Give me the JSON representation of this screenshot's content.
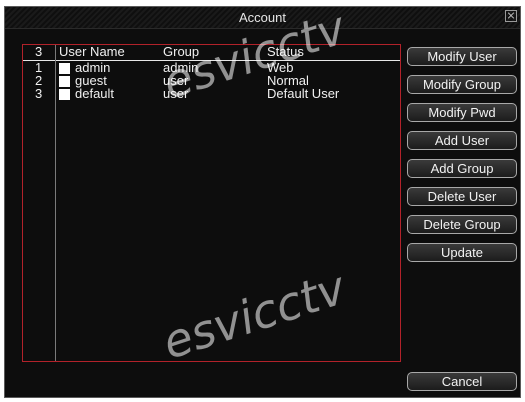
{
  "window": {
    "title": "Account"
  },
  "user_list": {
    "count": "3",
    "columns": [
      "User Name",
      "Group",
      "Status"
    ],
    "rows": [
      {
        "index": "1",
        "name": "admin",
        "group": "admin",
        "status": "Web"
      },
      {
        "index": "2",
        "name": "guest",
        "group": "user",
        "status": "Normal"
      },
      {
        "index": "3",
        "name": "default",
        "group": "user",
        "status": "Default User"
      }
    ]
  },
  "buttons": {
    "modify_user": "Modify User",
    "modify_group": "Modify Group",
    "modify_pwd": "Modify Pwd",
    "add_user": "Add User",
    "add_group": "Add Group",
    "delete_user": "Delete User",
    "delete_group": "Delete Group",
    "update": "Update",
    "cancel": "Cancel"
  },
  "watermark": {
    "text": "esvicctv"
  },
  "colors": {
    "background": "#0d0d0d",
    "list_border": "#b2222a",
    "text": "#f0f0f0"
  }
}
